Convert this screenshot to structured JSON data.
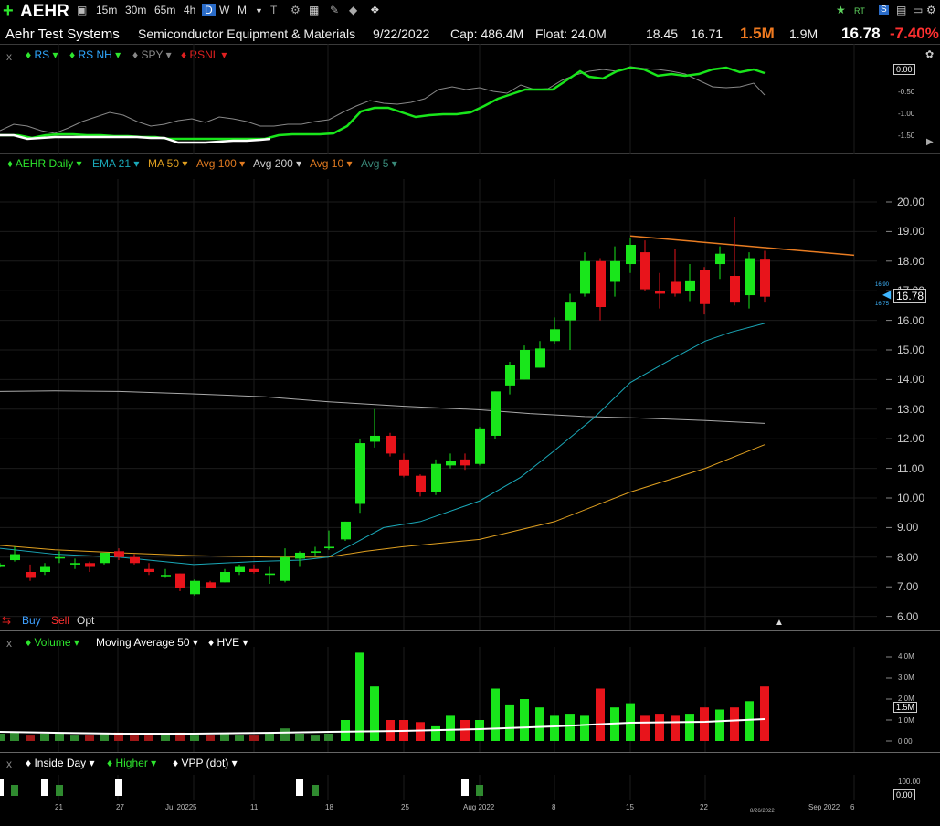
{
  "toolbar": {
    "symbol": "AEHR",
    "timeframes": [
      "15m",
      "30m",
      "65m",
      "4h",
      "D",
      "W",
      "M"
    ],
    "active_timeframe": "D"
  },
  "info": {
    "company": "Aehr Test Systems",
    "industry": "Semiconductor Equipment & Materials",
    "date": "9/22/2022",
    "cap": "Cap: 486.4M",
    "float": "Float: 24.0M",
    "v1": "18.45",
    "v2": "16.71",
    "volume": "1.5M",
    "avg_volume": "1.9M",
    "price": "16.78",
    "change": "-7.40%"
  },
  "rs_panel": {
    "items": [
      "RS",
      "RS NH",
      "SPY",
      "RSNL"
    ],
    "ticks": [
      "0.00",
      "-0.50",
      "-1.00",
      "-1.50"
    ]
  },
  "price_panel": {
    "items": [
      "AEHR Daily",
      "EMA 21",
      "MA 50",
      "Avg 100",
      "Avg 200",
      "Avg 10",
      "Avg 5"
    ],
    "ticks": [
      "20.00",
      "19.00",
      "18.00",
      "17.00",
      "16.00",
      "15.00",
      "14.00",
      "13.00",
      "12.00",
      "11.00",
      "10.00",
      "9.00",
      "8.00",
      "7.00",
      "6.00"
    ],
    "price_label": "16.78",
    "small_hi": "16.90",
    "small_lo": "16.75",
    "trade": [
      "Buy",
      "Sell",
      "Opt"
    ]
  },
  "volume_panel": {
    "items": [
      "Volume",
      "Moving Average 50",
      "HVE"
    ],
    "ticks": [
      "4.0M",
      "3.0M",
      "2.0M",
      "1.0M",
      "0.00"
    ],
    "vol_label": "1.5M"
  },
  "inside_panel": {
    "items": [
      "Inside Day",
      "Higher",
      "VPP (dot)"
    ],
    "ticks": [
      "100.00",
      "0.00"
    ]
  },
  "x_axis": {
    "labels": [
      "21",
      "27",
      "Jul 2022",
      "5",
      "11",
      "18",
      "25",
      "Aug 2022",
      "8",
      "15",
      "22",
      "Sep 2022",
      "6"
    ],
    "date_label": "8/26/2022"
  },
  "colors": {
    "up": "#19e61b",
    "down": "#e8141b",
    "ema21": "#1aa8b8",
    "ma50": "#e0a020",
    "avg200": "#bbbbbb",
    "trend": "#e87c22"
  }
}
